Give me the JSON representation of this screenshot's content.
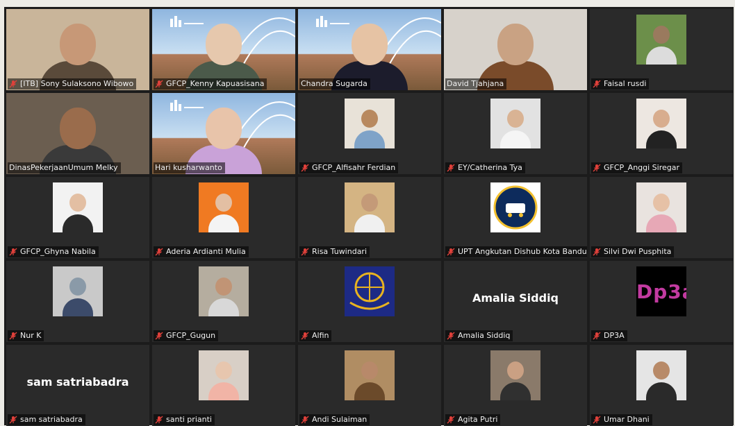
{
  "app": "video-conference-gallery",
  "colors": {
    "active_speaker_border": "#c6e85a",
    "muted_icon": "#e0403a",
    "label_text": "#f2f2f2"
  },
  "participants": [
    {
      "name": "[ITB] Sony Sulaksono Wibowo",
      "muted": true,
      "kind": "video",
      "bg": "#c9b59a",
      "skin": "#c79877",
      "shirt": "#5a4a3a"
    },
    {
      "name": "GFCP_Kenny Kapuasisana",
      "muted": true,
      "kind": "video-banner",
      "bg": "#7ea7d6",
      "skin": "#e6c8ad",
      "shirt": "#4b5a4a"
    },
    {
      "name": "Chandra Sugarda",
      "muted": false,
      "kind": "video-banner",
      "bg": "#7ea7d6",
      "skin": "#e6c3a4",
      "shirt": "#1c1c2c"
    },
    {
      "name": "David Tjahjana",
      "muted": false,
      "kind": "video",
      "bg": "#d7d2cb",
      "skin": "#c9a283",
      "shirt": "#7a4b2a"
    },
    {
      "name": "Faisal rusdi",
      "muted": true,
      "kind": "thumb",
      "bg": "#6c8f4a",
      "skin": "#9a7a5e",
      "shirt": "#dcdcdc"
    },
    {
      "name": "DinasPekerjaanUmum Melky",
      "muted": false,
      "kind": "video",
      "bg": "#6b5e50",
      "skin": "#9a6c4c",
      "shirt": "#3a3a3a"
    },
    {
      "name": "Hari kusharwanto",
      "muted": false,
      "kind": "video-banner",
      "bg": "#7ea7d6",
      "skin": "#e8c4aa",
      "shirt": "#c9a2d8",
      "active": true
    },
    {
      "name": "GFCP_Alfisahr Ferdian",
      "muted": true,
      "kind": "thumb",
      "bg": "#e8e2d8",
      "skin": "#b8895f",
      "shirt": "#7fa3c8"
    },
    {
      "name": "EY/Catherina Tya",
      "muted": true,
      "kind": "thumb",
      "bg": "#e2e2e2",
      "skin": "#d9b394",
      "shirt": "#f5f5f5"
    },
    {
      "name": "GFCP_Anggi Siregar",
      "muted": true,
      "kind": "thumb",
      "bg": "#ede7e1",
      "skin": "#d8ad8e",
      "shirt": "#222222"
    },
    {
      "name": "GFCP_Ghyna Nabila",
      "muted": true,
      "kind": "thumb",
      "bg": "#f2f2f2",
      "skin": "#e3bfa3",
      "shirt": "#2a2a2a"
    },
    {
      "name": "Aderia Ardianti Mulia",
      "muted": true,
      "kind": "thumb",
      "bg": "#f07a22",
      "skin": "#e3bfa3",
      "shirt": "#f4f4f4"
    },
    {
      "name": "Risa Tuwindari",
      "muted": true,
      "kind": "thumb",
      "bg": "#d4b483",
      "skin": "#c49a78",
      "shirt": "#f0f0f0"
    },
    {
      "name": "UPT Angkutan Dishub Kota Bandu...",
      "muted": true,
      "kind": "badge",
      "bg": "#0d2b5c",
      "skin": "#f3c02e",
      "shirt": "#ffffff"
    },
    {
      "name": "Silvi Dwi Pusphita",
      "muted": true,
      "kind": "thumb",
      "bg": "#e9e3df",
      "skin": "#e6c1a6",
      "shirt": "#e7a8b6"
    },
    {
      "name": "Nur K",
      "muted": true,
      "kind": "thumb",
      "bg": "#c9c9c9",
      "skin": "#8a9aa8",
      "shirt": "#3c4b6a"
    },
    {
      "name": "GFCP_Gugun",
      "muted": true,
      "kind": "thumb",
      "bg": "#b5ad9f",
      "skin": "#c19475",
      "shirt": "#d8d8d8"
    },
    {
      "name": "Alfin",
      "muted": true,
      "kind": "logo",
      "bg": "#1d2a85",
      "skin": "#e8b320",
      "shirt": "#e8b320"
    },
    {
      "name": "Amalia Siddiq",
      "muted": true,
      "kind": "text",
      "banner": "Amalia Siddiq"
    },
    {
      "name": "DP3A",
      "muted": true,
      "kind": "dp3a",
      "banner": "Dp3a"
    },
    {
      "name": "sam satriabadra",
      "muted": true,
      "kind": "text",
      "banner": "sam satriabadra"
    },
    {
      "name": "santi prianti",
      "muted": true,
      "kind": "thumb",
      "bg": "#d8cfc6",
      "skin": "#e7c6ae",
      "shirt": "#f1b4a6"
    },
    {
      "name": "Andi Sulaiman",
      "muted": true,
      "kind": "thumb",
      "bg": "#b08d63",
      "skin": "#b8896a",
      "shirt": "#6b4a2a"
    },
    {
      "name": "Agita Putri",
      "muted": true,
      "kind": "thumb",
      "bg": "#8a7a6a",
      "skin": "#caa083",
      "shirt": "#303030"
    },
    {
      "name": "Umar Dhani",
      "muted": true,
      "kind": "thumb",
      "bg": "#e5e5e5",
      "skin": "#b88a68",
      "shirt": "#2a2a2a"
    }
  ]
}
